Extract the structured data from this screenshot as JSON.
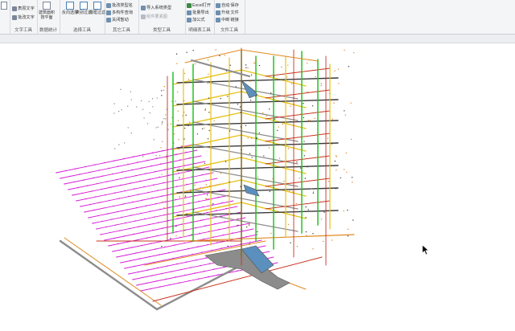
{
  "ribbon": {
    "groups": [
      {
        "title": "文字工具",
        "items": [
          "表原文字",
          "批改文字"
        ]
      },
      {
        "title": "数据统计",
        "items": [
          "建筑面积",
          "按平面"
        ]
      },
      {
        "title": "选择工具",
        "items": [
          "反向选择",
          "类别过滤",
          "隔框过滤"
        ]
      },
      {
        "title": "其它工具",
        "items": [
          "批改类型名",
          "多构件查询",
          "关闭暂动"
        ]
      },
      {
        "title": "类型工具",
        "items": [
          "导入系统类型",
          "组件要素图"
        ]
      },
      {
        "title": "明细表工具",
        "items": [
          "Excel打开",
          "批量导出",
          "加公式"
        ]
      },
      {
        "title": "文件工具",
        "items": [
          "自动",
          "保存",
          "升级",
          "文件",
          "中断",
          "链接"
        ]
      }
    ]
  },
  "colors": {
    "green": "#22c422",
    "yellow": "#e6c21a",
    "orange": "#e08a22",
    "magenta": "#d61fd6",
    "red": "#c8321e",
    "gray": "#8c8c8c",
    "dark": "#3a3a3a",
    "blue": "#5b8fbd"
  },
  "canvas": {
    "icons": [
      "mouse-pointer-icon"
    ]
  }
}
